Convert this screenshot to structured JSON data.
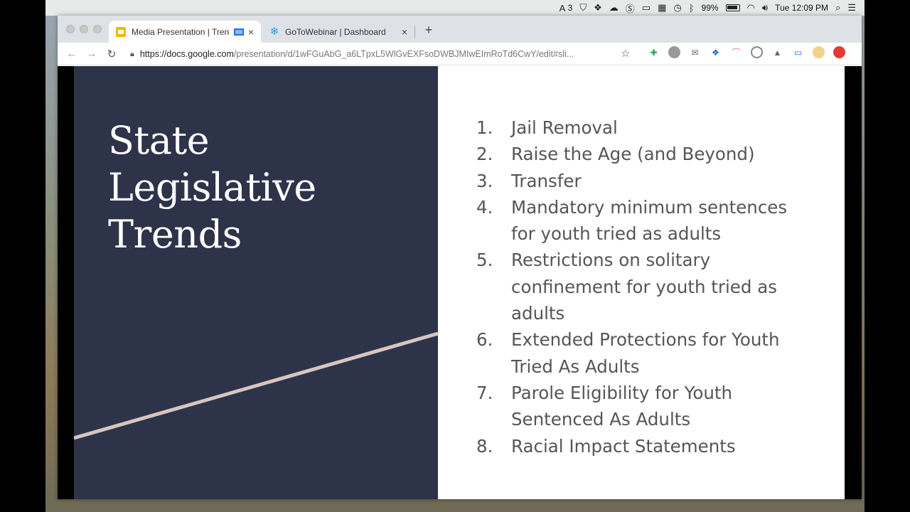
{
  "menubar": {
    "adobe_count": "3",
    "battery": "99%",
    "clock": "Tue 12:09 PM"
  },
  "browser": {
    "tabs": [
      {
        "title": "Media Presentation | Trends",
        "favicon": "slides-icon",
        "active": true
      },
      {
        "title": "GoToWebinar | Dashboard",
        "favicon": "gotowebinar-icon",
        "active": false
      }
    ],
    "new_tab_label": "+",
    "close_label": "×",
    "url_host": "https://docs.google.com",
    "url_path": "/presentation/d/1wFGuAbG_a6LTpxL5WlGvEXFsoDWBJMIwEImRoTd6CwY/edit#sli..."
  },
  "slide": {
    "title_lines": [
      "State",
      "Legislative",
      "Trends"
    ],
    "items": [
      {
        "num": "1.",
        "text": "Jail Removal"
      },
      {
        "num": "2.",
        "text": "Raise the Age (and Beyond)"
      },
      {
        "num": "3.",
        "text": "Transfer"
      },
      {
        "num": "4.",
        "text": "Mandatory minimum sentences for youth tried as adults"
      },
      {
        "num": "5.",
        "text": "Restrictions on solitary confinement for youth tried as adults"
      },
      {
        "num": "6.",
        "text": "Extended Protections for Youth Tried As Adults"
      },
      {
        "num": "7.",
        "text": "Parole Eligibility for Youth Sentenced As Adults"
      },
      {
        "num": "8.",
        "text": "Racial Impact Statements"
      }
    ],
    "colors": {
      "left_panel": "#2d3349",
      "accent_line": "#d6c6bd",
      "list_text": "#555555"
    }
  }
}
